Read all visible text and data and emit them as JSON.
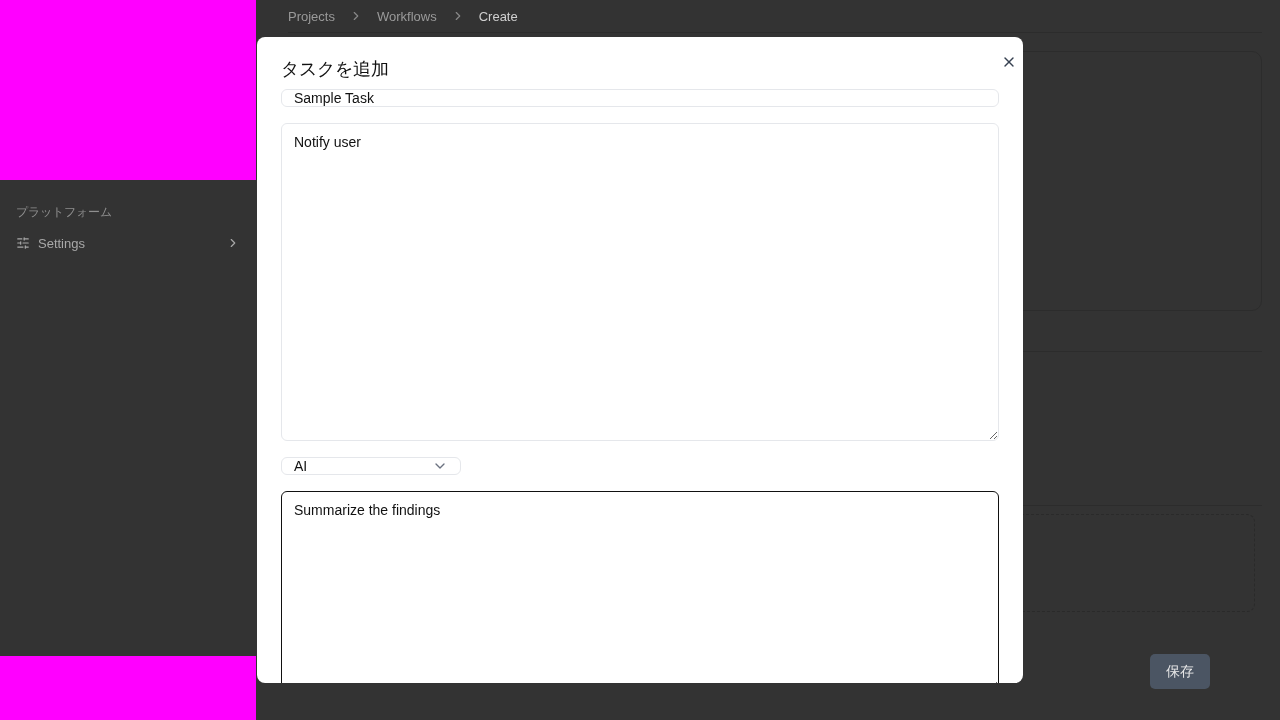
{
  "sidebar": {
    "group_label": "プラットフォーム",
    "items": [
      {
        "label": "Settings"
      }
    ]
  },
  "breadcrumb": [
    {
      "label": "Projects",
      "current": false
    },
    {
      "label": "Workflows",
      "current": false
    },
    {
      "label": "Create",
      "current": true
    }
  ],
  "save_button": "保存",
  "dialog": {
    "title": "タスクを追加",
    "name_field": {
      "value": "Sample Task"
    },
    "description_field": {
      "value": "Notify user"
    },
    "type_select": {
      "value": "AI"
    },
    "prompt_field": {
      "value": "Summarize the findings",
      "focused": true
    }
  }
}
